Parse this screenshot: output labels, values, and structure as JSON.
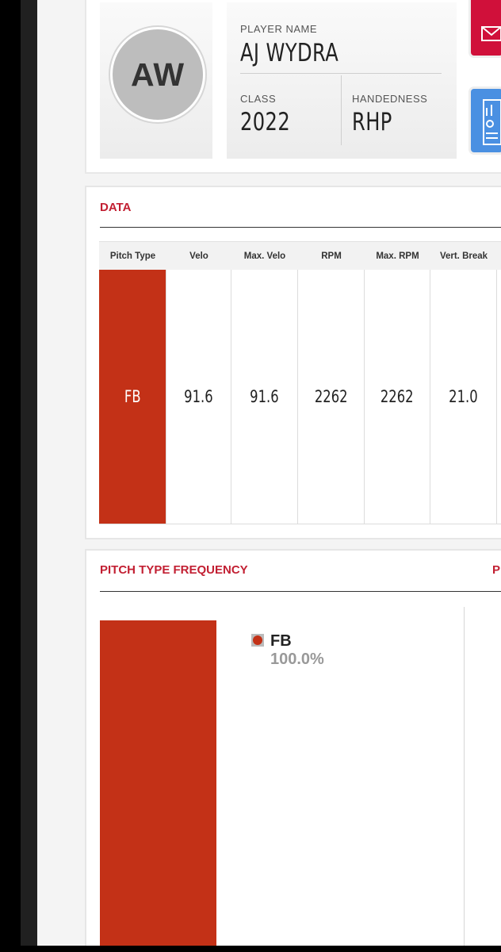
{
  "player": {
    "initials": "AW",
    "name_label": "PLAYER NAME",
    "name": "AJ WYDRA",
    "class_label": "CLASS",
    "class_year": "2022",
    "handedness_label": "HANDEDNESS",
    "handedness": "RHP"
  },
  "data_section": {
    "title": "DATA",
    "columns": [
      "Pitch Type",
      "Velo",
      "Max. Velo",
      "RPM",
      "Max. RPM",
      "Vert. Break"
    ],
    "rows": [
      [
        "FB",
        "91.6",
        "91.6",
        "2262",
        "2262",
        "21.0"
      ]
    ]
  },
  "frequency_section": {
    "title": "PITCH TYPE FREQUENCY",
    "next_title_fragment": "P",
    "legend": [
      {
        "name": "FB",
        "percent": "100.0%"
      }
    ]
  },
  "chart_data": {
    "type": "bar",
    "categories": [
      "FB"
    ],
    "values": [
      100.0
    ],
    "title": "PITCH TYPE FREQUENCY",
    "xlabel": "",
    "ylabel": "",
    "ylim": [
      0,
      100
    ]
  },
  "colors": {
    "accent": "#c21f32",
    "fb": "#c33117",
    "mail_button": "#d0103a",
    "stats_button": "#4a90e2"
  },
  "icons": {
    "mail_button": "envelope-icon",
    "stats_button": "clipboard-chart-icon"
  }
}
